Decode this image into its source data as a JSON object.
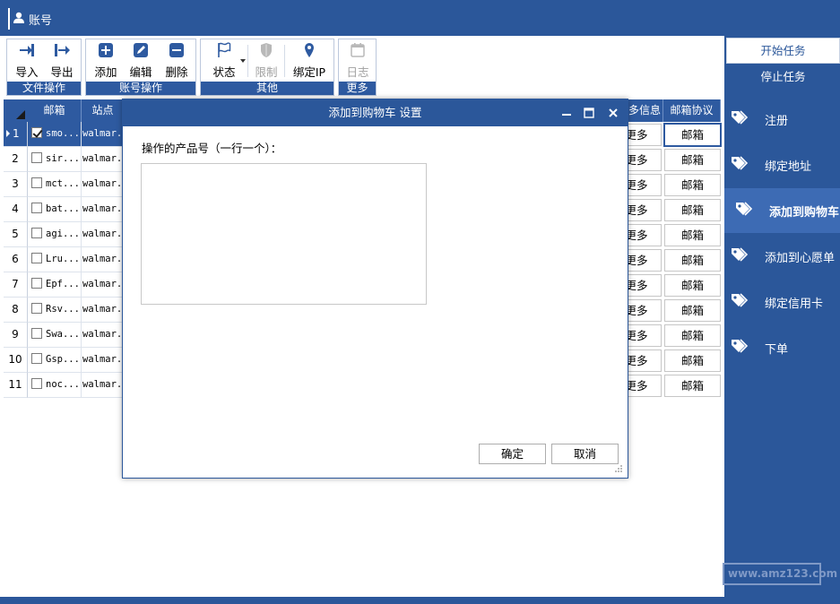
{
  "titlebar": {
    "title": "账号"
  },
  "ribbon": {
    "groups": [
      {
        "label": "文件操作",
        "buttons": [
          {
            "label": "导入",
            "icon": "import-icon"
          },
          {
            "label": "导出",
            "icon": "export-icon"
          }
        ]
      },
      {
        "label": "账号操作",
        "buttons": [
          {
            "label": "添加",
            "icon": "add-icon"
          },
          {
            "label": "编辑",
            "icon": "edit-icon"
          },
          {
            "label": "删除",
            "icon": "delete-icon"
          }
        ]
      },
      {
        "label": "其他",
        "buttons": [
          {
            "label": "状态",
            "icon": "flag-icon"
          },
          {
            "label": "限制",
            "icon": "shield-icon",
            "disabled": true
          },
          {
            "label": "绑定IP",
            "icon": "location-pin-icon"
          }
        ]
      },
      {
        "label": "更多",
        "buttons": [
          {
            "label": "日志",
            "icon": "calendar-icon",
            "disabled": true
          }
        ]
      }
    ]
  },
  "grid": {
    "columns": {
      "email": "邮箱",
      "site": "站点",
      "more_info": "多信息",
      "email_protocol": "邮箱协议"
    },
    "more_cell_label": "更多",
    "protocol_button_label": "邮箱",
    "rows": [
      {
        "num": "1",
        "email": "smo...",
        "site": "walmar...",
        "checked": true,
        "selected": true
      },
      {
        "num": "2",
        "email": "sir...",
        "site": "walmar...",
        "checked": false
      },
      {
        "num": "3",
        "email": "mct...",
        "site": "walmar...",
        "checked": false
      },
      {
        "num": "4",
        "email": "bat...",
        "site": "walmar...",
        "checked": false
      },
      {
        "num": "5",
        "email": "agi...",
        "site": "walmar...",
        "checked": false
      },
      {
        "num": "6",
        "email": "Lru...",
        "site": "walmar...",
        "checked": false
      },
      {
        "num": "7",
        "email": "Epf...",
        "site": "walmar...",
        "checked": false
      },
      {
        "num": "8",
        "email": "Rsv...",
        "site": "walmar...",
        "checked": false
      },
      {
        "num": "9",
        "email": "Swa...",
        "site": "walmar...",
        "checked": false
      },
      {
        "num": "10",
        "email": "Gsp...",
        "site": "walmar...",
        "checked": false
      },
      {
        "num": "11",
        "email": "noc...",
        "site": "walmar...",
        "checked": false
      }
    ]
  },
  "right_panel": {
    "start_task": "开始任务",
    "stop_task": "停止任务",
    "tasks": [
      {
        "label": "注册",
        "active": false
      },
      {
        "label": "绑定地址",
        "active": false
      },
      {
        "label": "添加到购物车",
        "active": true
      },
      {
        "label": "添加到心愿单",
        "active": false
      },
      {
        "label": "绑定信用卡",
        "active": false
      },
      {
        "label": "下单",
        "active": false
      }
    ],
    "watermark": "www.amz123.com"
  },
  "dialog": {
    "title": "添加到购物车 设置",
    "prompt": "操作的产品号（一行一个）：",
    "textarea_value": "",
    "ok_label": "确定",
    "cancel_label": "取消"
  },
  "colors": {
    "brand_blue": "#2b579a",
    "header_blue": "#2e5aa0",
    "active_task": "#3d6bb4"
  }
}
